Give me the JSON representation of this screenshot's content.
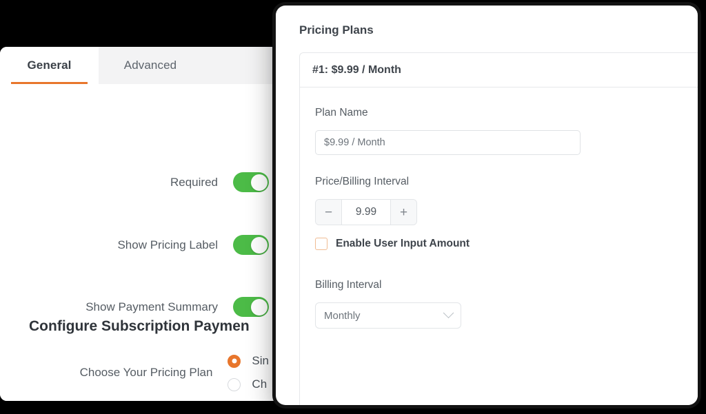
{
  "left_panel": {
    "tabs": [
      {
        "label": "General",
        "active": true
      },
      {
        "label": "Advanced",
        "active": false
      }
    ],
    "toggles": [
      {
        "label": "Required",
        "state": "on"
      },
      {
        "label": "Show Pricing Label",
        "state": "on"
      },
      {
        "label": "Show Payment Summary",
        "state": "on"
      }
    ],
    "section_heading": "Configure Subscription Paymen",
    "pricing_plan_field": {
      "label": "Choose Your Pricing Plan",
      "options": [
        {
          "label": "Sin",
          "selected": true
        },
        {
          "label": "Ch",
          "selected": false
        }
      ]
    }
  },
  "right_panel": {
    "title": "Pricing Plans",
    "plan": {
      "header": "#1: $9.99 / Month",
      "plan_name": {
        "label": "Plan Name",
        "value": "$9.99 / Month",
        "placeholder": "$9.99 / Month"
      },
      "price_billing": {
        "label": "Price/Billing Interval",
        "decrement": "−",
        "value": "9.99",
        "increment": "+"
      },
      "user_input_amount": {
        "label": "Enable User Input Amount",
        "checked": false
      },
      "billing_interval": {
        "label": "Billing Interval",
        "value": "Monthly"
      }
    }
  },
  "colors": {
    "accent_orange": "#e8762c",
    "toggle_green": "#4cbb47",
    "panel_border": "#131313"
  }
}
